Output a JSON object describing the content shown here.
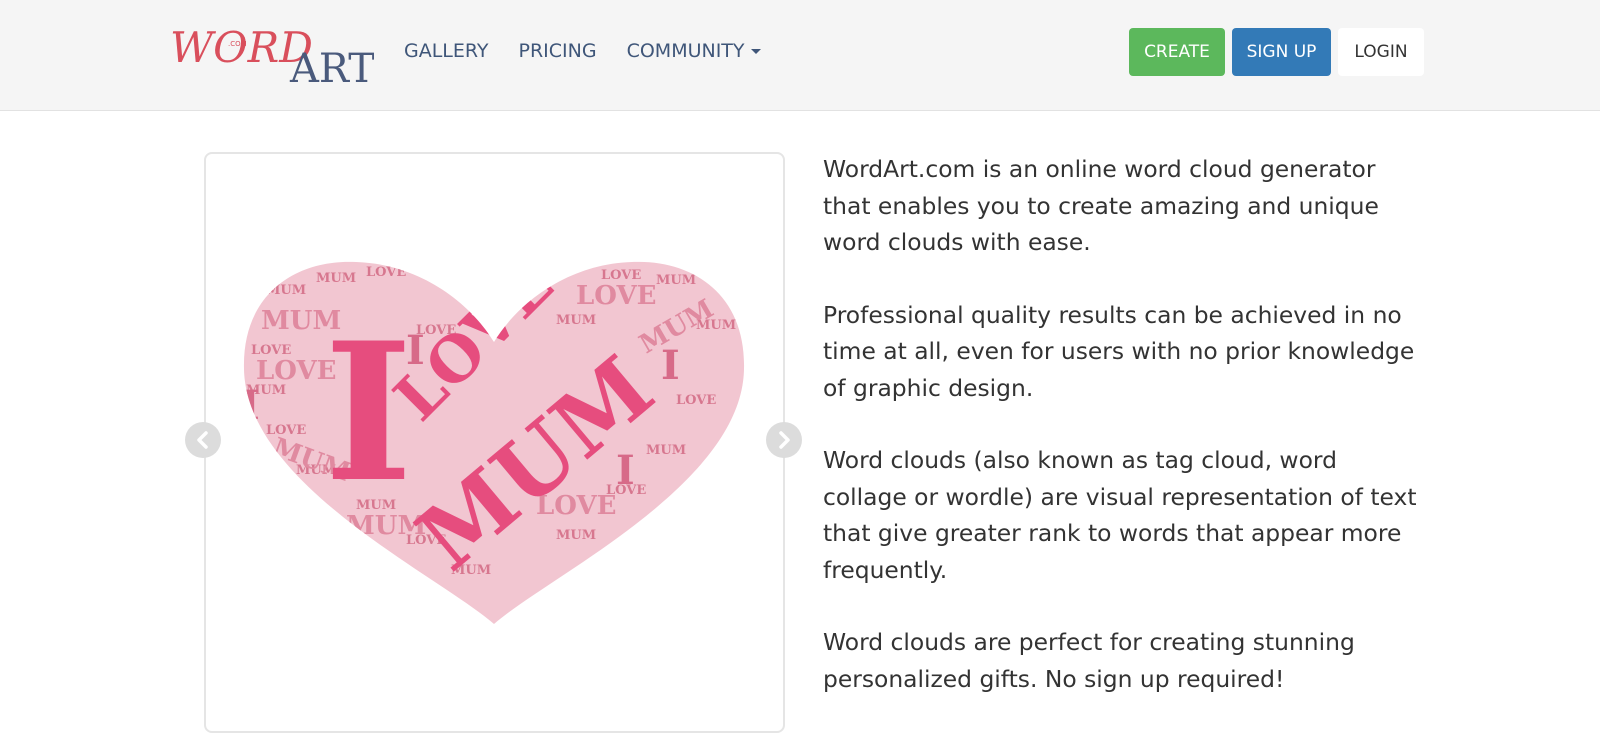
{
  "brand": {
    "logo_word": "WORD",
    "logo_art": "ART",
    "logo_com": ".COM",
    "colors": {
      "word": "#d94f5c",
      "art": "#4a5a7c"
    }
  },
  "nav": {
    "links": [
      {
        "label": "GALLERY"
      },
      {
        "label": "PRICING"
      },
      {
        "label": "COMMUNITY"
      }
    ],
    "buttons": {
      "create": "CREATE",
      "signup": "SIGN UP",
      "login": "LOGIN"
    },
    "colors": {
      "link": "#3f5679",
      "create": "#5cb85c",
      "signup": "#337ab7"
    }
  },
  "carousel": {
    "prev_icon": "chevron-left-icon",
    "next_icon": "chevron-right-icon",
    "image_words": {
      "big_i": "I",
      "love": "LOVE",
      "mum": "MUM"
    }
  },
  "description": {
    "paragraphs": [
      "WordArt.com is an online word cloud generator that enables you to create amazing and unique word clouds with ease.",
      "Professional quality results can be achieved in no time at all, even for users with no prior knowledge of graphic design.",
      "Word clouds (also known as tag cloud, word collage or wordle) are visual representation of text that give greater rank to words that appear more frequently.",
      "Word clouds are perfect for creating stunning personalized gifts. No sign up required!"
    ]
  }
}
